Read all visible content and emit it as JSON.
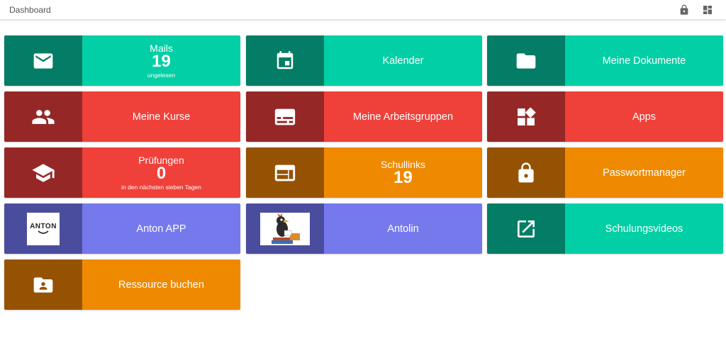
{
  "header": {
    "title": "Dashboard",
    "lock_icon": "lock-icon",
    "layout_icon": "dashboard-layout-icon"
  },
  "colors": {
    "green_dark": "#037d65",
    "green_light": "#02cfa5",
    "red_dark": "#962727",
    "red_light": "#ef403a",
    "orange_dark": "#955203",
    "orange_light": "#ef8a00",
    "purple_dark": "#4a4d9d",
    "purple_light": "#7679ec"
  },
  "tiles": {
    "mails": {
      "title": "Mails",
      "count": "19",
      "subtitle": "ungelesen",
      "icon": "mail-icon"
    },
    "kalender": {
      "label": "Kalender",
      "icon": "calendar-icon"
    },
    "dokumente": {
      "label": "Meine Dokumente",
      "icon": "folder-icon"
    },
    "kurse": {
      "label": "Meine Kurse",
      "icon": "people-icon"
    },
    "arbeitsgruppen": {
      "label": "Meine Arbeitsgruppen",
      "icon": "subtitles-card-icon"
    },
    "apps": {
      "label": "Apps",
      "icon": "widgets-icon"
    },
    "pruefungen": {
      "title": "Prüfungen",
      "count": "0",
      "subtitle": "in den nächsten sieben Tagen",
      "icon": "graduation-cap-icon"
    },
    "schullinks": {
      "title": "Schullinks",
      "count": "19",
      "icon": "web-icon"
    },
    "passwort": {
      "label": "Passwortmanager",
      "icon": "lock-icon"
    },
    "anton": {
      "label": "Anton APP",
      "logo_text": "ANTON",
      "icon": "anton-logo"
    },
    "antolin": {
      "label": "Antolin",
      "icon": "antolin-raven-image"
    },
    "videos": {
      "label": "Schulungsvideos",
      "icon": "open-in-new-icon"
    },
    "ressource": {
      "label": "Ressource buchen",
      "icon": "folder-user-icon"
    }
  }
}
